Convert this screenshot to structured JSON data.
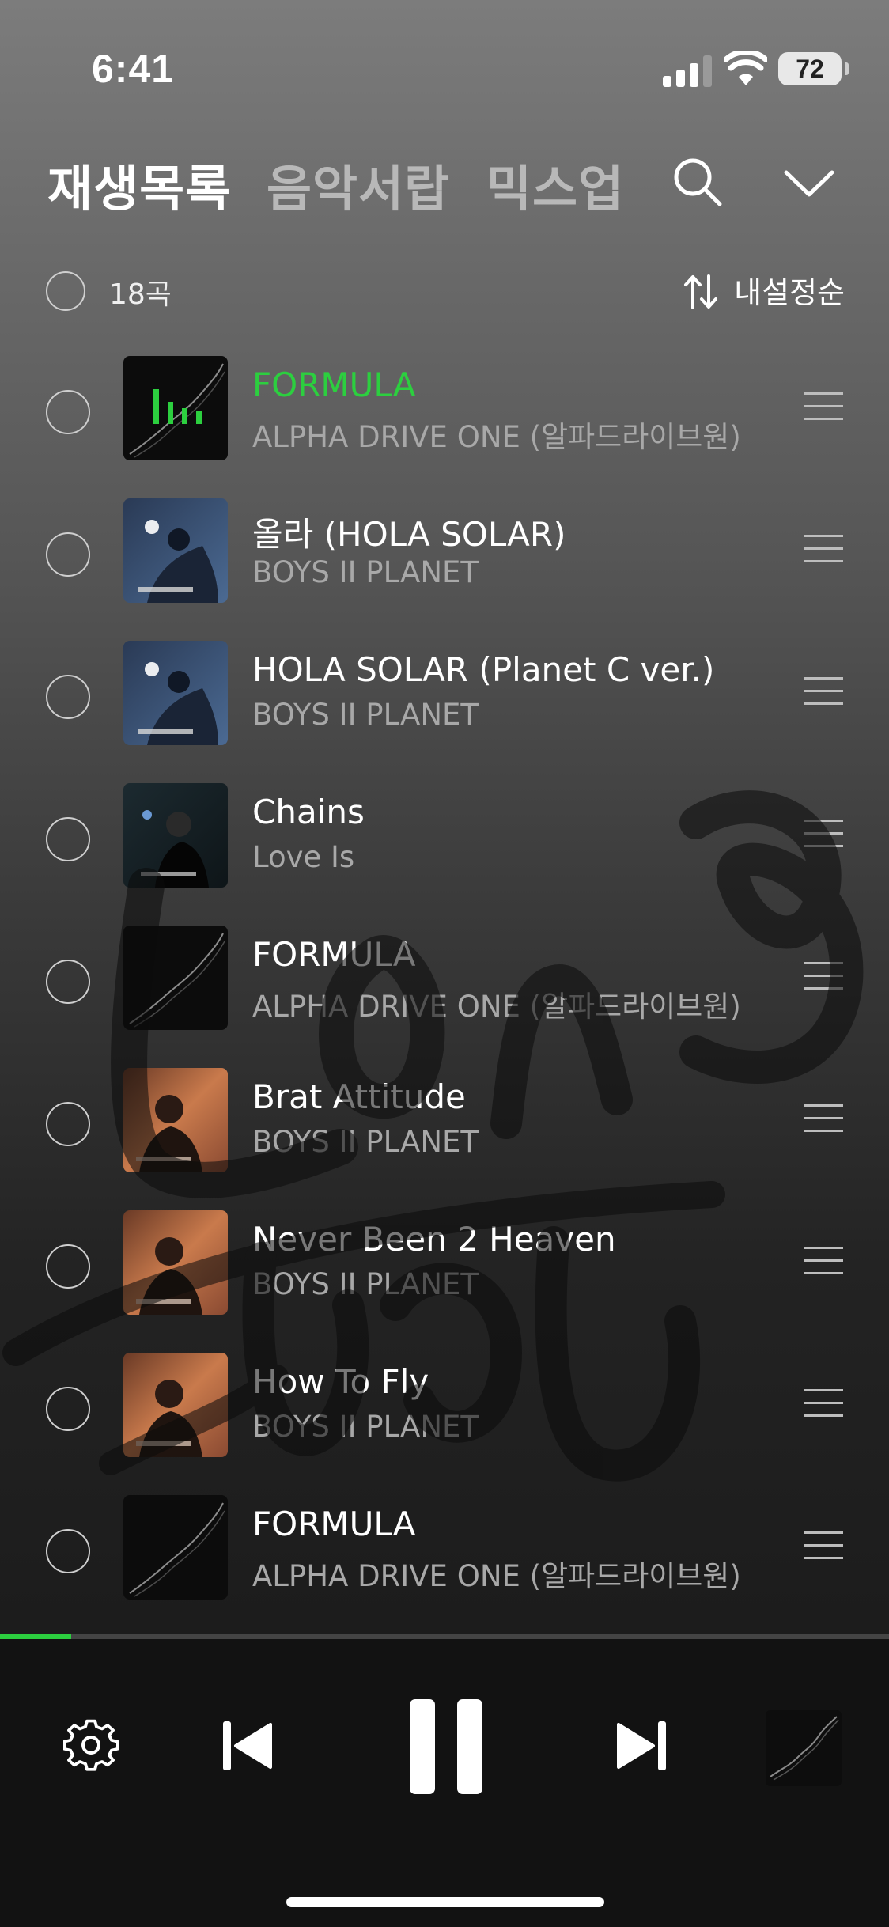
{
  "status_bar": {
    "time": "6:41",
    "battery": "72"
  },
  "header": {
    "tabs": [
      {
        "label": "재생목록",
        "active": true
      },
      {
        "label": "음악서랍",
        "active": false
      },
      {
        "label": "믹스업",
        "active": false
      }
    ],
    "search_icon": "search-icon",
    "collapse_icon": "chevron-down-icon"
  },
  "toolbar": {
    "count": "18곡",
    "sort_label": "내설정순",
    "sort_icon": "sort-arrows-icon"
  },
  "tracks": [
    {
      "title": "FORMULA",
      "artist": "ALPHA DRIVE ONE (알파드라이브원)",
      "playing": true,
      "art": "formula"
    },
    {
      "title": "올라 (HOLA SOLAR)",
      "artist": "BOYS II PLANET",
      "playing": false,
      "art": "blue"
    },
    {
      "title": "HOLA SOLAR (Planet C ver.)",
      "artist": "BOYS II PLANET",
      "playing": false,
      "art": "blue"
    },
    {
      "title": "Chains",
      "artist": "Love Is",
      "playing": false,
      "art": "dark-teal"
    },
    {
      "title": "FORMULA",
      "artist": "ALPHA DRIVE ONE (알파드라이브원)",
      "playing": false,
      "art": "formula"
    },
    {
      "title": "Brat Attitude",
      "artist": "BOYS II PLANET",
      "playing": false,
      "art": "orange"
    },
    {
      "title": "Never Been 2 Heaven",
      "artist": "BOYS II PLANET",
      "playing": false,
      "art": "orange"
    },
    {
      "title": "How To Fly",
      "artist": "BOYS II PLANET",
      "playing": false,
      "art": "orange"
    },
    {
      "title": "FORMULA",
      "artist": "ALPHA DRIVE ONE (알파드라이브원)",
      "playing": false,
      "art": "formula"
    }
  ],
  "player": {
    "progress": 0.08,
    "controls": [
      "settings-icon",
      "previous-icon",
      "pause-icon",
      "next-icon"
    ],
    "accent": "#2ccf3f"
  }
}
